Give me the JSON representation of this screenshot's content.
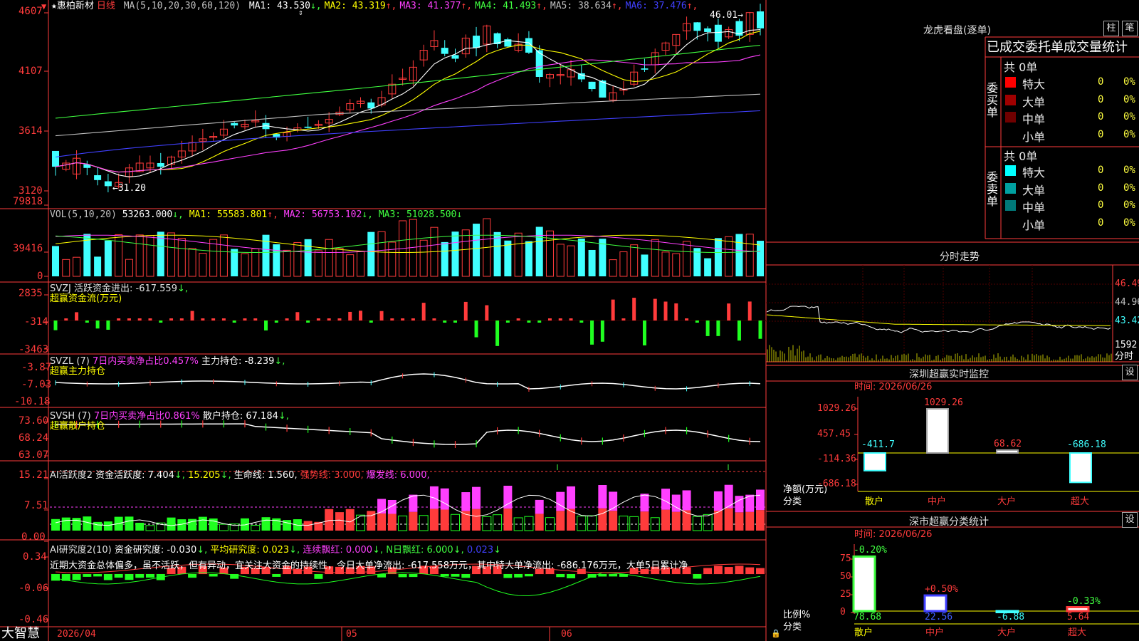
{
  "main": {
    "y_ticks": [
      "4607",
      "4107",
      "3614",
      "3120"
    ],
    "stock_name": "惠柏新材",
    "period": "日线",
    "ma_params": "MA(5,10,20,30,60,120)",
    "ma": [
      {
        "label": "MA1:",
        "value": "43.530",
        "arrow": "↓",
        "color": "#ffffff"
      },
      {
        "label": "MA2:",
        "value": "43.319",
        "arrow": "↑",
        "color": "#ffff00"
      },
      {
        "label": "MA3:",
        "value": "41.377",
        "arrow": "↑",
        "color": "#ff40ff"
      },
      {
        "label": "MA4:",
        "value": "41.493",
        "arrow": "↑",
        "color": "#40ff40"
      },
      {
        "label": "MA5:",
        "value": "38.634",
        "arrow": "↑",
        "color": "#c0c0c0"
      },
      {
        "label": "MA6:",
        "value": "37.476",
        "arrow": "↑",
        "color": "#4040ff"
      }
    ],
    "high_mark": "46.01",
    "low_mark": "31.20"
  },
  "vol": {
    "y_ticks": [
      "79818",
      "39416",
      "0"
    ],
    "params": "VOL(5,10,20)",
    "value": "53263.000",
    "ma1": "MA1: 55583.801",
    "ma2": "MA2: 56753.102",
    "ma3": "MA3: 51028.500"
  },
  "svzj": {
    "y_ticks": [
      "2835",
      "-314",
      "-3463"
    ],
    "line1": "SVZJ  活跃资金进出: -617.559",
    "line2": "超赢资金流(万元)"
  },
  "svzl": {
    "y_ticks": [
      "-3.87",
      "-7.03",
      "-10.18"
    ],
    "prefix": "SVZL (7)",
    "ratio": "7日内买卖净占比0.457%",
    "hold": "主力持仓: -8.239",
    "line2": "超赢主力持仓"
  },
  "svsh": {
    "y_ticks": [
      "73.60",
      "68.24",
      "63.07"
    ],
    "prefix": "SVSH (7)",
    "ratio": "7日内买卖净占比0.861%",
    "hold": "散户持仓: 67.184",
    "line2": "超赢散户持仓"
  },
  "ai1": {
    "y_ticks": [
      "15.21",
      "7.51",
      "0.00"
    ],
    "title": "AI活跃度2",
    "v1": "资金活跃度: 7.404",
    "v2": "15.205",
    "v3": "生命线: 1.560",
    "v4": "强势线: 3.000",
    "v5": "爆发线: 6.000"
  },
  "ai2": {
    "y_ticks": [
      "0.34",
      "-0.06",
      "-0.46"
    ],
    "title": "AI研究度2(10)",
    "v1": "资金研究度: -0.030",
    "v2": "平均研究度: 0.023",
    "v3": "连续飘红: 0.000",
    "v4": "N日飘红: 6.000",
    "v5": "0.023",
    "comment": "近期大资金总体偏多，虽不活跃，但有异动，宜关注大资金的持续性，今日大单净流出: -617.558万元，其中特大单净流出: -686.176万元，大单5日累计净"
  },
  "footer": {
    "brand": "大智慧",
    "dates": [
      "2026/04",
      "05",
      "06"
    ]
  },
  "right": {
    "lhb": {
      "title": "龙虎看盘(逐单)",
      "btn1": "柱",
      "btn2": "笔",
      "header": "已成交委托单成交量统计",
      "buy_label": "委买单",
      "sell_label": "委卖单",
      "buy_total": "共 0单",
      "sell_total": "共 0单",
      "buy_rows": [
        {
          "name": "特大",
          "count": "0",
          "pct": "0%",
          "color": "#ff0000"
        },
        {
          "name": "大单",
          "count": "0",
          "pct": "0%",
          "color": "#a00000"
        },
        {
          "name": "中单",
          "count": "0",
          "pct": "0%",
          "color": "#700000"
        },
        {
          "name": "小单",
          "count": "0",
          "pct": "0%",
          "color": "#000000"
        }
      ],
      "sell_rows": [
        {
          "name": "特大",
          "count": "0",
          "pct": "0%",
          "color": "#00ffff"
        },
        {
          "name": "大单",
          "count": "0",
          "pct": "0%",
          "color": "#00a0a0"
        },
        {
          "name": "中单",
          "count": "0",
          "pct": "0%",
          "color": "#007878"
        },
        {
          "name": "小单",
          "count": "0",
          "pct": "0%",
          "color": "#000000"
        }
      ]
    },
    "fenshi": {
      "title": "分时走势",
      "y_ticks": [
        "46.49",
        "44.96",
        "43.42"
      ],
      "vol_label": "1592",
      "tag": "分时"
    },
    "szcy": {
      "title": "深圳超赢实时监控",
      "btn": "设",
      "time": "时间: 2026/06/26",
      "y_ticks": [
        "1029.26",
        "457.45",
        "-114.36",
        "-686.18"
      ],
      "unit": "净额(万元)",
      "cat_label": "分类",
      "chart_data": {
        "type": "bar",
        "categories": [
          "散户",
          "中户",
          "大户",
          "超大"
        ],
        "values": [
          -411.7,
          1029.26,
          68.62,
          -686.18
        ],
        "value_labels": [
          "-411.7",
          "1029.26",
          "68.62",
          "-686.18"
        ]
      }
    },
    "scfl": {
      "title": "深市超赢分类统计",
      "btn": "设",
      "time": "时间: 2026/06/26",
      "y_ticks": [
        "75",
        "50",
        "25",
        "0"
      ],
      "unit": "比例%",
      "cat_label": "分类",
      "chart_data": {
        "type": "bar",
        "categories": [
          "散户",
          "中户",
          "大户",
          "超大"
        ],
        "values": [
          78.68,
          22.56,
          -6.88,
          5.64
        ],
        "changes": [
          "-0.20%",
          "+0.50%",
          "",
          "-0.33%"
        ],
        "value_labels": [
          "78.68",
          "22.56",
          "-6.88",
          "5.64"
        ]
      }
    }
  }
}
